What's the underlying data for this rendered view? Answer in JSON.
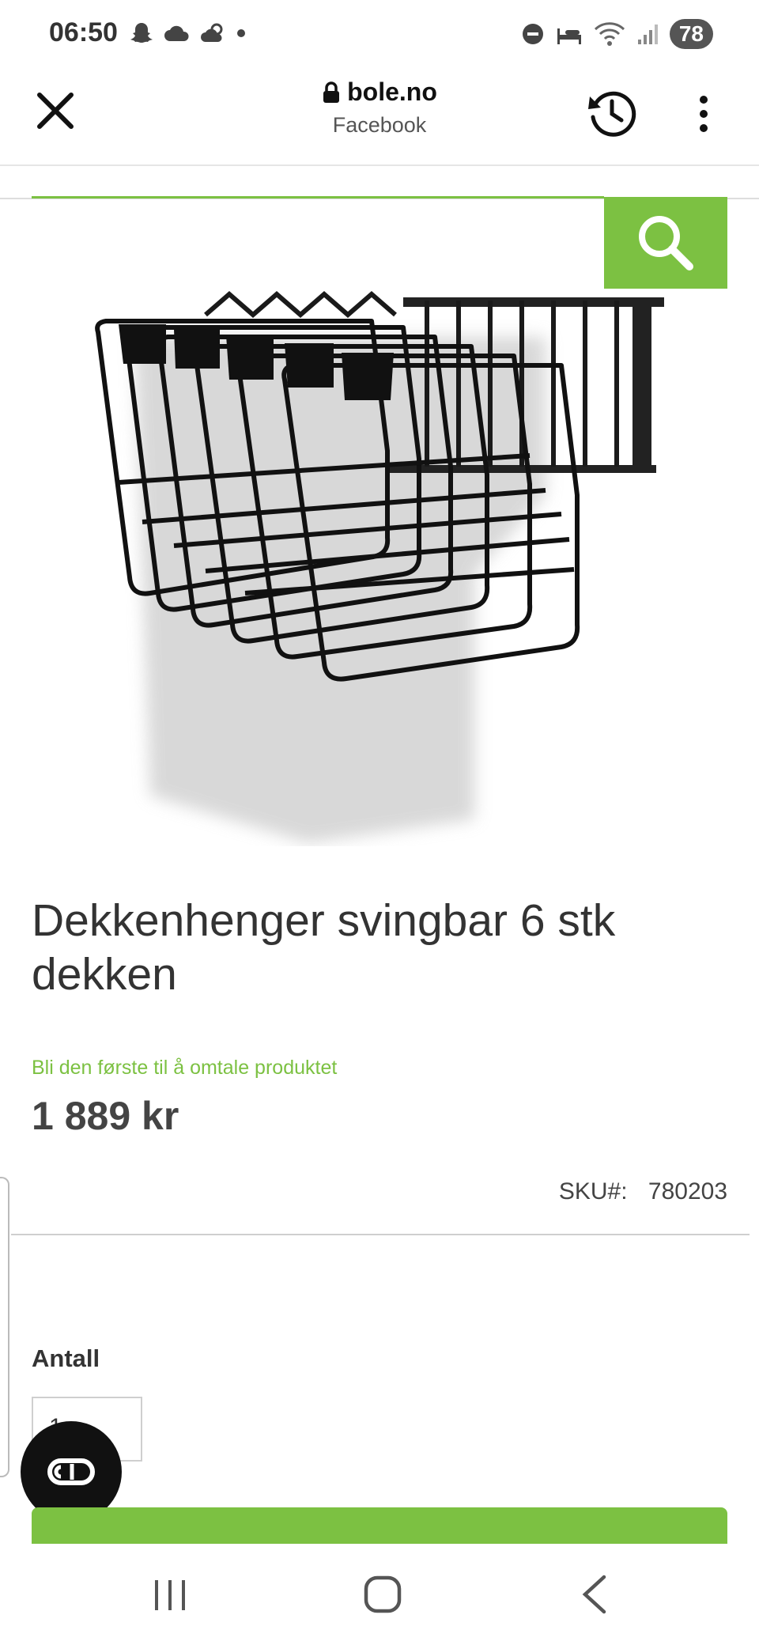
{
  "status_bar": {
    "time": "06:50",
    "battery": "78",
    "left_icons": [
      "snapchat-icon",
      "cloud-icon",
      "partly-cloudy-icon",
      "dot-icon"
    ],
    "right_icons": [
      "do-not-disturb-icon",
      "sleep-mode-icon",
      "wifi-icon",
      "signal-icon"
    ]
  },
  "browser": {
    "url": "bole.no",
    "subtitle": "Facebook",
    "icons": [
      "close-icon",
      "lock-icon",
      "history-icon",
      "more-vert-icon"
    ]
  },
  "site": {
    "accent_color": "#7cc142",
    "search_icon": "search-icon"
  },
  "product": {
    "title": "Dekkenhenger svingbar 6 stk dekken",
    "review_link": "Bli den første til å omtale produktet",
    "price": "1 889 kr",
    "sku_label": "SKU#:",
    "sku_value": "780203",
    "quantity_label": "Antall",
    "quantity_value": "1"
  },
  "fab": {
    "icon": "chat-icon"
  },
  "nav_bar": {
    "icons": [
      "recents-icon",
      "home-icon",
      "back-icon"
    ]
  }
}
